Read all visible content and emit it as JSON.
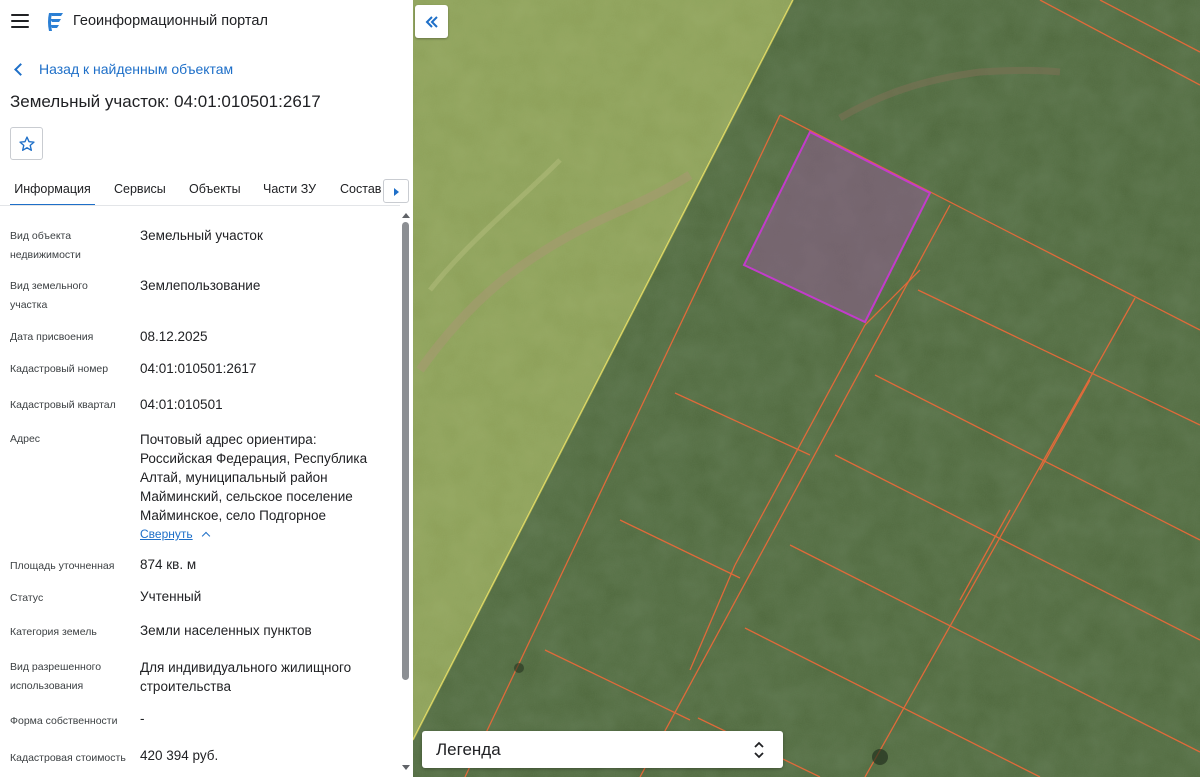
{
  "app": {
    "title": "Геоинформационный портал"
  },
  "nav": {
    "back_label": "Назад к найденным объектам"
  },
  "object": {
    "title": "Земельный участок: 04:01:010501:2617"
  },
  "tabs": [
    {
      "label": "Информация",
      "active": true
    },
    {
      "label": "Сервисы",
      "active": false
    },
    {
      "label": "Объекты",
      "active": false
    },
    {
      "label": "Части ЗУ",
      "active": false
    },
    {
      "label": "Состав",
      "active": false
    }
  ],
  "info": {
    "rows": [
      {
        "label": "Вид объекта недвижимости",
        "value": "Земельный участок"
      },
      {
        "label": "Вид земельного участка",
        "value": "Землепользование"
      },
      {
        "label": "Дата присвоения",
        "value": "08.12.2025"
      },
      {
        "label": "Кадастровый номер",
        "value": "04:01:010501:2617"
      },
      {
        "label": "Кадастровый квартал",
        "value": "04:01:010501"
      },
      {
        "label": "Адрес",
        "value": "Почтовый адрес ориентира: Российская Федерация, Республика Алтай, муниципальный район Майминский, сельское поселение Майминское, село Подгорное"
      },
      {
        "label": "Площадь уточненная",
        "value": "874 кв. м"
      },
      {
        "label": "Статус",
        "value": "Учтенный"
      },
      {
        "label": "Категория земель",
        "value": "Земли населенных пунктов"
      },
      {
        "label": "Вид разрешенного использования",
        "value": "Для индивидуального жилищного строительства"
      },
      {
        "label": "Форма собственности",
        "value": "-"
      },
      {
        "label": "Кадастровая стоимость",
        "value": "420 394 руб."
      }
    ],
    "collapse_label": "Свернуть"
  },
  "map": {
    "legend_label": "Легенда",
    "colors": {
      "imagery": "#4f6b3c",
      "zone_overlay": "#c8cf78",
      "parcel_border": "#e06a3a",
      "selected_fill": "#8a5f8a",
      "selected_border": "#c23ccb",
      "zone_edge": "#e9e26a"
    }
  }
}
